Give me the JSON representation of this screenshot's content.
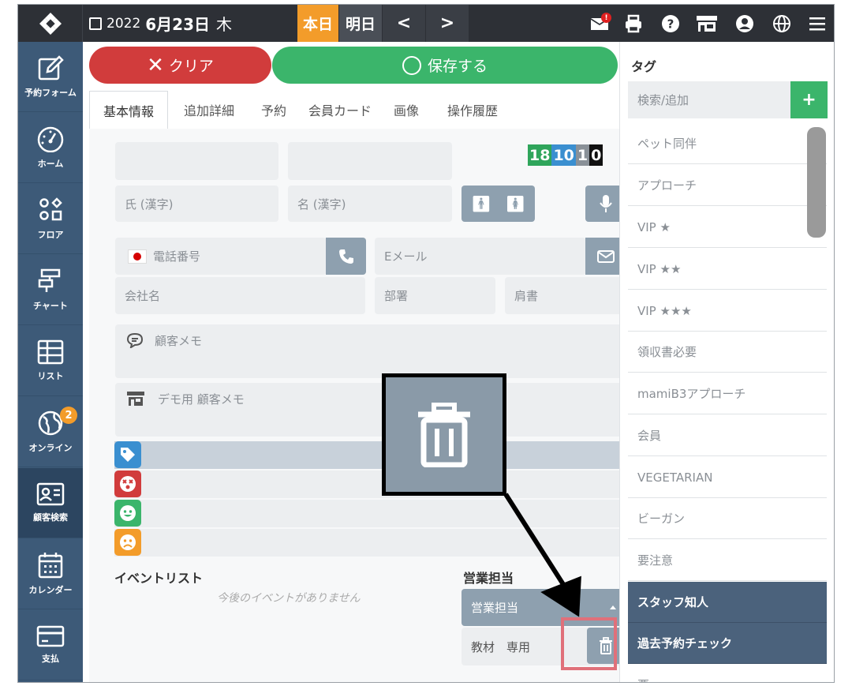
{
  "topbar": {
    "year": "2022",
    "date": "6月23日",
    "weekday": "木",
    "today_label": "本日",
    "tomorrow_label": "明日",
    "prev_label": "<",
    "next_label": ">",
    "notification_badge": "!"
  },
  "sidebar": {
    "items": [
      {
        "label": "予約フォーム",
        "icon": "edit-icon"
      },
      {
        "label": "ホーム",
        "icon": "dashboard-icon"
      },
      {
        "label": "フロア",
        "icon": "floor-icon"
      },
      {
        "label": "チャート",
        "icon": "chart-icon"
      },
      {
        "label": "リスト",
        "icon": "list-icon"
      },
      {
        "label": "オンライン",
        "icon": "globe-icon",
        "badge": "2"
      },
      {
        "label": "顧客検索",
        "icon": "id-card-icon"
      },
      {
        "label": "カレンダー",
        "icon": "calendar-icon"
      },
      {
        "label": "支払",
        "icon": "credit-card-icon"
      }
    ]
  },
  "actions": {
    "clear_label": "クリア",
    "save_label": "保存する"
  },
  "tabs": [
    "基本情報",
    "追加詳細",
    "予約",
    "会員カード",
    "画像",
    "操作履歴"
  ],
  "counts": [
    "18",
    "10",
    "1",
    "0"
  ],
  "form": {
    "last_name_placeholder": "氏 (漢字)",
    "first_name_placeholder": "名 (漢字)",
    "phone_placeholder": "電話番号",
    "email_placeholder": "Eメール",
    "company_placeholder": "会社名",
    "department_placeholder": "部署",
    "title_placeholder": "肩書",
    "memo_placeholder": "顧客メモ",
    "demo_memo_placeholder": "デモ用 顧客メモ"
  },
  "events": {
    "title": "イベントリスト",
    "empty": "今後のイベントがありません"
  },
  "sales": {
    "title": "営業担当",
    "select_value": "営業担当",
    "entry": "教材　専用"
  },
  "tags_panel": {
    "title": "タグ",
    "search_placeholder": "検索/追加",
    "add_label": "+",
    "items": [
      "ペット同伴",
      "アプローチ",
      "VIP ★",
      "VIP ★★",
      "VIP ★★★",
      "領収書必要",
      "mamiB3アプローチ",
      "会員",
      "VEGETARIAN",
      "ビーガン",
      "要注意",
      "スタッフ知人",
      "過去予約チェック",
      "悪"
    ],
    "colors": {
      "accent": "#3bb56b",
      "selected": "#4b627c"
    }
  }
}
